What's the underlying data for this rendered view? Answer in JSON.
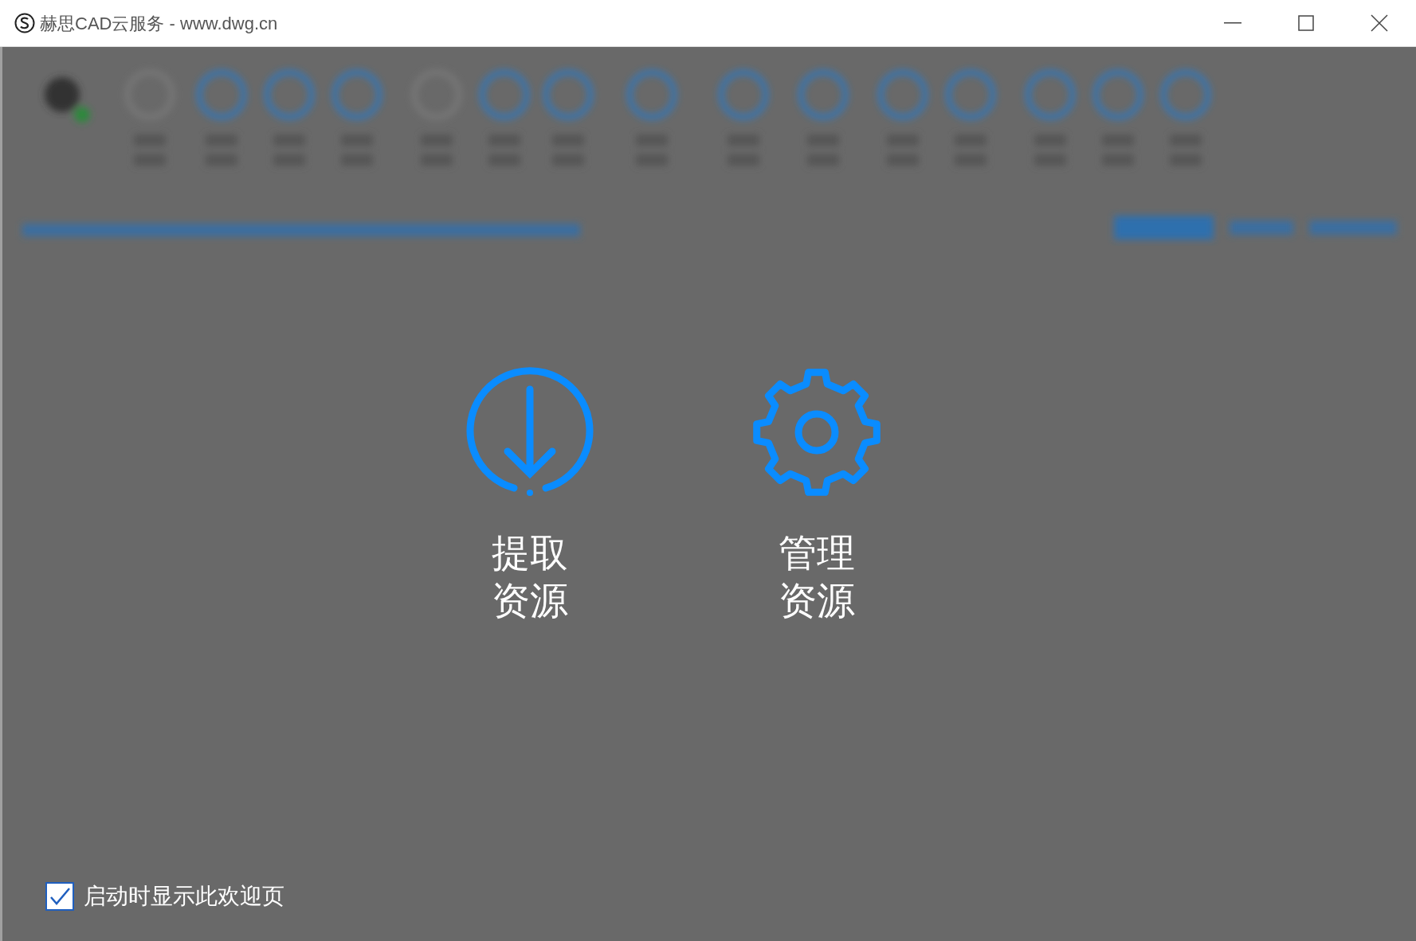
{
  "window": {
    "title": "赫思CAD云服务 - www.dwg.cn"
  },
  "actions": [
    {
      "kind": "download",
      "label": "提取资源"
    },
    {
      "kind": "settings",
      "label": "管理资源"
    }
  ],
  "startup_checkbox": {
    "label": "启动时显示此欢迎页",
    "checked": true
  }
}
